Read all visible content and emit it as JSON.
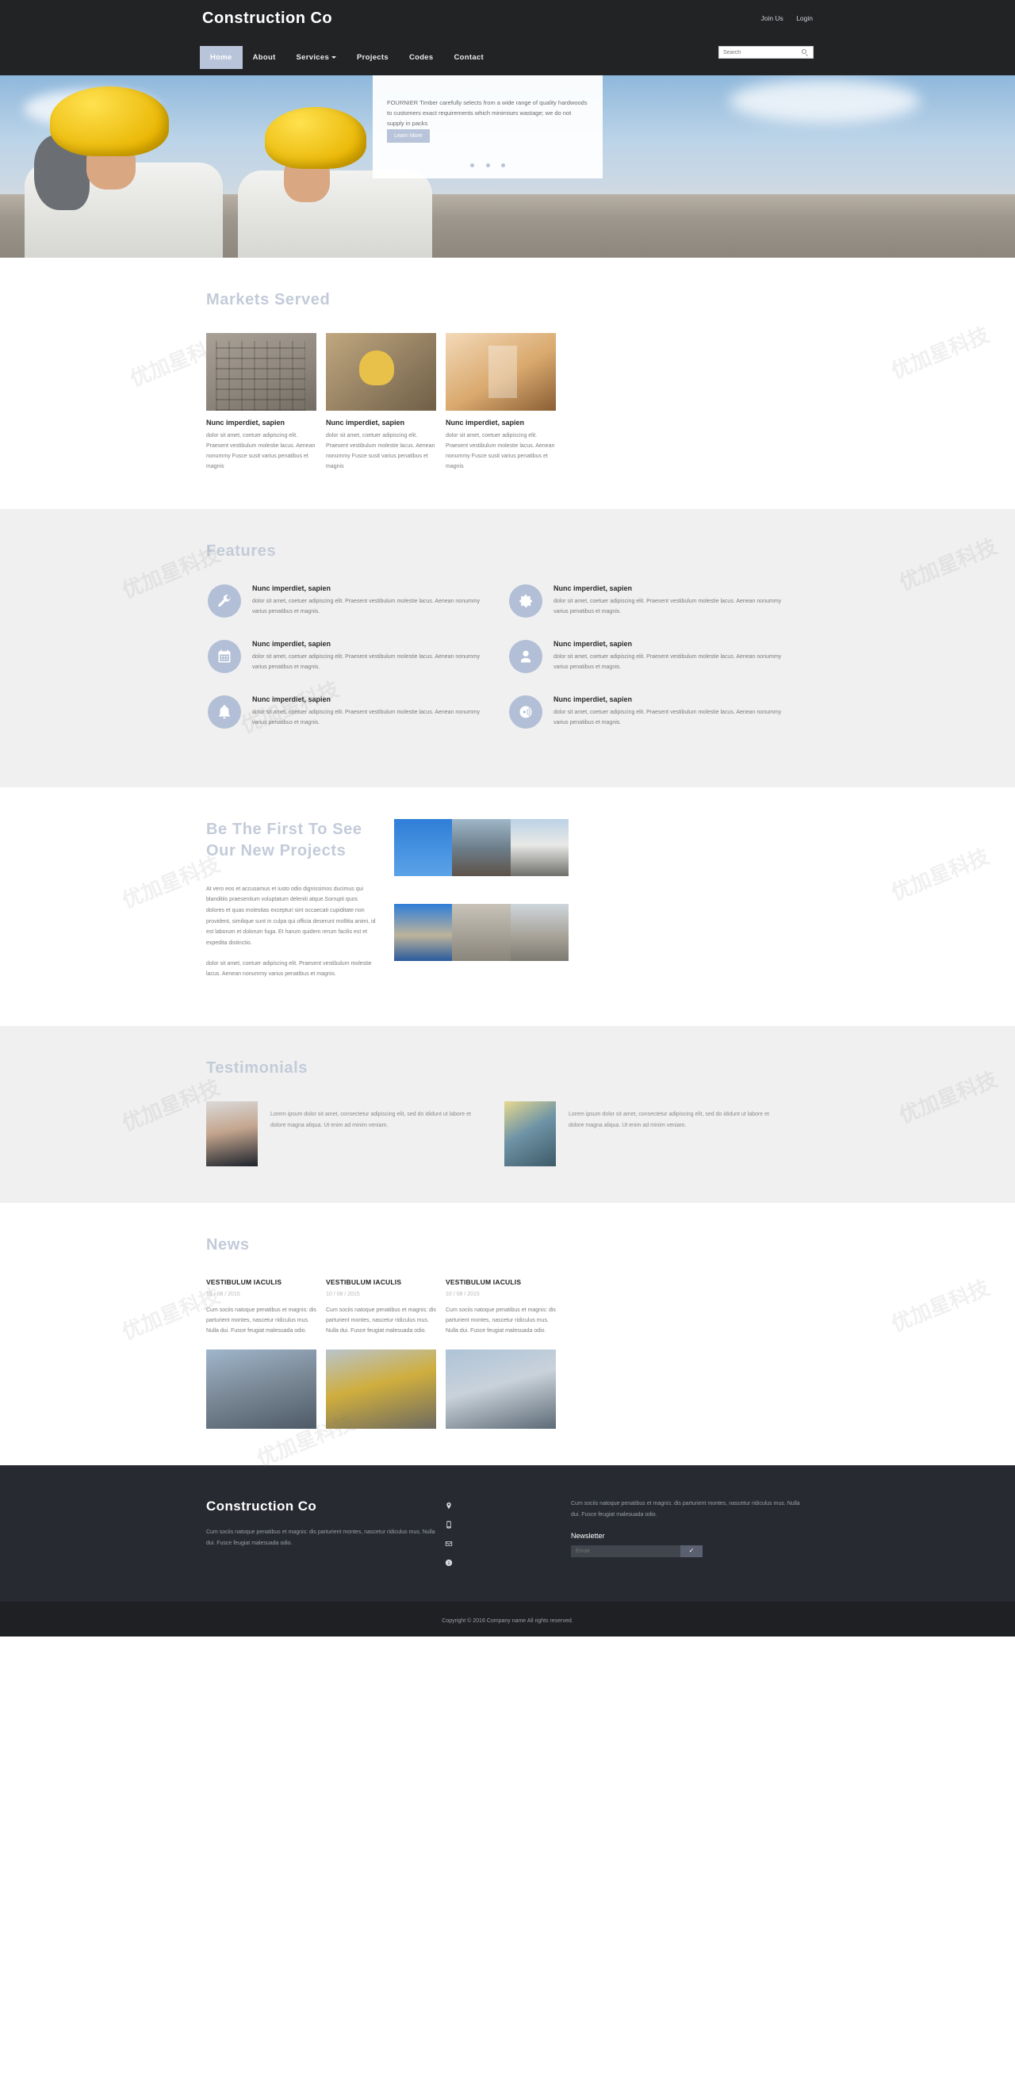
{
  "header": {
    "brand": "Construction Co",
    "auth_links": [
      {
        "label": "Join Us"
      },
      {
        "label": "Login"
      }
    ],
    "nav": [
      {
        "label": "Home",
        "active": true
      },
      {
        "label": "About",
        "active": false
      },
      {
        "label": "Services",
        "active": false,
        "has_dropdown": true
      },
      {
        "label": "Projects",
        "active": false
      },
      {
        "label": "Codes",
        "active": false
      },
      {
        "label": "Contact",
        "active": false
      }
    ],
    "search": {
      "placeholder": "Search",
      "value": "",
      "icon": "search-icon"
    }
  },
  "hero": {
    "text": "FOURNIER Timber carefully selects from a wide range of quality hardwoods to customers exact requirements which minimises wastage; we do not supply in packs",
    "button_label": "Learn More",
    "slides": 3,
    "active_slide": 1
  },
  "markets": {
    "title": "Markets Served",
    "cards": [
      {
        "heading": "Nunc imperdiet, sapien",
        "body": "dolor sit amet, coetuer adipiscing elit. Praesent vestibulum molestie lacus. Aenean nonummy Fusce susit varius penatibus et magnis",
        "image_alt": "scaffolded-building-photo"
      },
      {
        "heading": "Nunc imperdiet, sapien",
        "body": "dolor sit amet, coetuer adipiscing elit. Praesent vestibulum molestie lacus. Aenean nonummy Fusce susit varius penatibus et magnis",
        "image_alt": "worker-with-hardhat-photo"
      },
      {
        "heading": "Nunc imperdiet, sapien",
        "body": "dolor sit amet, coetuer adipiscing elit. Praesent vestibulum molestie lacus. Aenean nonummy Fusce susit varius penatibus et magnis",
        "image_alt": "interior-hallway-photo"
      }
    ]
  },
  "features": {
    "title": "Features",
    "items": [
      {
        "icon": "wrench-icon",
        "heading": "Nunc imperdiet, sapien",
        "body": "dolor sit amet, coetuer adipiscing elit. Praesent vestibulum molestie lacus. Aenean nonummy varius penatibus et magnis."
      },
      {
        "icon": "gear-icon",
        "heading": "Nunc imperdiet, sapien",
        "body": "dolor sit amet, coetuer adipiscing elit. Praesent vestibulum molestie lacus. Aenean nonummy varius penatibus et magnis."
      },
      {
        "icon": "calendar-icon",
        "heading": "Nunc imperdiet, sapien",
        "body": "dolor sit amet, coetuer adipiscing elit. Praesent vestibulum molestie lacus. Aenean nonummy varius penatibus et magnis."
      },
      {
        "icon": "user-icon",
        "heading": "Nunc imperdiet, sapien",
        "body": "dolor sit amet, coetuer adipiscing elit. Praesent vestibulum molestie lacus. Aenean nonummy varius penatibus et magnis."
      },
      {
        "icon": "bell-icon",
        "heading": "Nunc imperdiet, sapien",
        "body": "dolor sit amet, coetuer adipiscing elit. Praesent vestibulum molestie lacus. Aenean nonummy varius penatibus et magnis."
      },
      {
        "icon": "broadcast-icon",
        "heading": "Nunc imperdiet, sapien",
        "body": "dolor sit amet, coetuer adipiscing elit. Praesent vestibulum molestie lacus. Aenean nonummy varius penatibus et magnis."
      }
    ]
  },
  "projects": {
    "title": "Be The First To See Our New Projects",
    "paragraph1": "At vero eos et accusamus et iusto odio dignissimos ducimus qui blanditiis praesentium voluptatum deleniti atque.Sorrupti quos dolores et quas molestias excepturi sint occaecati cupiditate non provident, similique sunt in culpa qui officia deserunt mollitia animi, id est laborum et dolorum fuga. Et harum quidem rerum facilis est et expedita distinctio.",
    "paragraph2": "dolor sit amet, coetuer adipiscing elit. Praesent vestibulum molestie lacus. Aenean nonummy varius penatibus et magnis.",
    "gallery": [
      {
        "alt": "tower-crane-photo"
      },
      {
        "alt": "bridge-skyline-photo"
      },
      {
        "alt": "modular-building-photo"
      },
      {
        "alt": "column-scaffold-photo"
      },
      {
        "alt": "balcony-facade-photo"
      },
      {
        "alt": "concrete-bridge-photo"
      }
    ]
  },
  "testimonials": {
    "title": "Testimonials",
    "items": [
      {
        "avatar_alt": "man-in-suit-portrait",
        "quote": "Lorem ipsum dolor sit amet, consectetur adipiscing elit, sed do ididunt ut labore et dolore magna aliqua. Ut enim ad minim veniam."
      },
      {
        "avatar_alt": "young-man-portrait",
        "quote": "Lorem ipsum dolor sit amet, consectetur adipiscing elit, sed do ididunt ut labore et dolore magna aliqua. Ut enim ad minim veniam."
      }
    ]
  },
  "news": {
    "title": "News",
    "items": [
      {
        "heading": "VESTIBULUM IACULIS",
        "date": "10 / 08 / 2015",
        "body": "Cum sociis natoque penatibus et magnis: dis parturient montes, nascetur ridiculus mus. Nulla dui. Fusce feugiat malesuada odio.",
        "image_alt": "city-skyline-construction-photo"
      },
      {
        "heading": "VESTIBULUM IACULIS",
        "date": "10 / 08 / 2015",
        "body": "Cum sociis natoque penatibus et magnis: dis parturient montes, nascetur ridiculus mus. Nulla dui. Fusce feugiat malesuada odio.",
        "image_alt": "yellow-excavator-photo"
      },
      {
        "heading": "VESTIBULUM IACULIS",
        "date": "10 / 08 / 2015",
        "body": "Cum sociis natoque penatibus et magnis: dis parturient montes, nascetur ridiculus mus. Nulla dui. Fusce feugiat malesuada odio.",
        "image_alt": "bridge-roadway-photo"
      }
    ]
  },
  "footer": {
    "brand": "Construction Co",
    "about": "Cum sociis natoque penatibus et magnis: dis parturient montes, nascetur ridiculus mus. Nulla dui. Fusce feugiat malesuada odio.",
    "contact_icons": [
      {
        "icon": "location-pin-icon"
      },
      {
        "icon": "mobile-phone-icon"
      },
      {
        "icon": "envelope-icon"
      },
      {
        "icon": "info-circle-icon"
      }
    ],
    "right_text": "Cum sociis natoque penatibus et magnis: dis parturient montes, nascetur ridiculus mus. Nulla dui. Fusce feugiat malesuada odio.",
    "newsletter": {
      "label": "Newsletter",
      "placeholder": "Email",
      "value": "",
      "submit_icon": "check-icon"
    },
    "copyright": "Copyright © 2016 Company name All rights reserved."
  },
  "colors": {
    "accent": "#b8c4da",
    "heading": "#c3cbd9",
    "dark": "#222325",
    "footer_bg": "#272a31",
    "copy_bg": "#1f2024",
    "section_light": "#f0f0f0"
  }
}
